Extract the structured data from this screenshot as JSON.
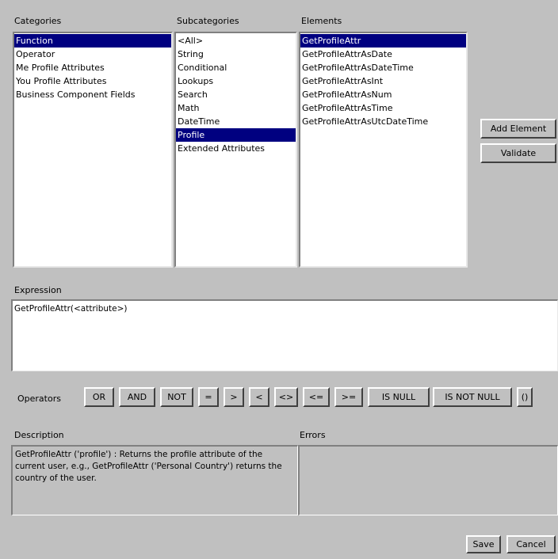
{
  "categories": {
    "label": "Categories",
    "items": [
      "Function",
      "Operator",
      "Me Profile Attributes",
      "You Profile Attributes",
      "Business Component Fields"
    ],
    "selected": "Function"
  },
  "subcategories": {
    "label": "Subcategories",
    "items": [
      "<All>",
      "String",
      "Conditional",
      "Lookups",
      "Search",
      "Math",
      "DateTime",
      "Profile",
      "Extended Attributes"
    ],
    "selected": "Profile"
  },
  "elements": {
    "label": "Elements",
    "items": [
      "GetProfileAttr",
      "GetProfileAttrAsDate",
      "GetProfileAttrAsDateTime",
      "GetProfileAttrAsInt",
      "GetProfileAttrAsNum",
      "GetProfileAttrAsTime",
      "GetProfileAttrAsUtcDateTime"
    ],
    "selected": "GetProfileAttr"
  },
  "actions": {
    "add_element": "Add Element",
    "validate": "Validate"
  },
  "expression": {
    "label": "Expression",
    "value": "GetProfileAttr(<attribute>)"
  },
  "operators": {
    "label": "Operators",
    "buttons": [
      "OR",
      "AND",
      "NOT",
      "=",
      ">",
      "<",
      "<>",
      "<=",
      ">=",
      "IS NULL",
      "IS NOT NULL",
      "()"
    ]
  },
  "description": {
    "label": "Description",
    "text": "GetProfileAttr ('profile') : Returns the profile attribute of the current user, e.g., GetProfileAttr ('Personal Country') returns the country of the user."
  },
  "errors": {
    "label": "Errors",
    "text": ""
  },
  "footer": {
    "save": "Save",
    "cancel": "Cancel"
  }
}
